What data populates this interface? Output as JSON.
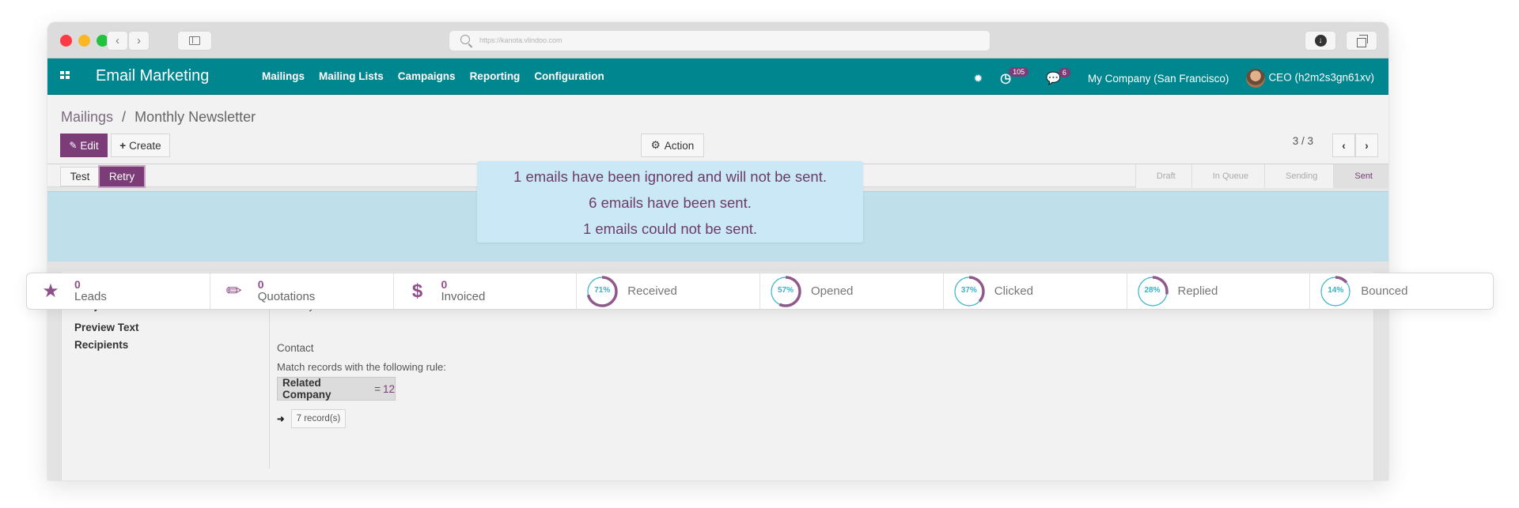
{
  "browser": {
    "url": "https://kanota.vlindoo.com",
    "back_icon": "chevron-left-icon",
    "forward_icon": "chevron-right-icon",
    "sidebar_icon": "sidebar-icon",
    "download_icon": "download-icon",
    "tabs_icon": "tabs-icon"
  },
  "navbar": {
    "app_title": "Email Marketing",
    "menu": [
      "Mailings",
      "Mailing Lists",
      "Campaigns",
      "Reporting",
      "Configuration"
    ],
    "activity_count": "105",
    "messages_count": "6",
    "company": "My Company (San Francisco)",
    "user": "CEO (h2m2s3gn61xv)"
  },
  "breadcrumb": {
    "parent": "Mailings",
    "separator": "/",
    "current": "Monthly Newsletter"
  },
  "toolbar": {
    "edit_label": "Edit",
    "create_label": "Create",
    "action_label": "Action",
    "pager": "3 / 3"
  },
  "header_buttons": {
    "test_label": "Test",
    "retry_label": "Retry"
  },
  "stages": [
    {
      "label": "Draft",
      "active": false
    },
    {
      "label": "In Queue",
      "active": false
    },
    {
      "label": "Sending",
      "active": false
    },
    {
      "label": "Sent",
      "active": true
    }
  ],
  "alert": {
    "lines": [
      "1  emails have been ignored and will not be sent.",
      "6  emails have been sent.",
      "1  emails could not be sent."
    ]
  },
  "stats": {
    "counters": [
      {
        "value": "0",
        "label": "Leads",
        "icon": "star-icon"
      },
      {
        "value": "0",
        "label": "Quotations",
        "icon": "pencil-icon"
      },
      {
        "value": "0",
        "label": "Invoiced",
        "icon": "dollar-icon"
      }
    ],
    "rates": [
      {
        "percent": 71,
        "text": "71%",
        "label": "Received"
      },
      {
        "percent": 57,
        "text": "57%",
        "label": "Opened"
      },
      {
        "percent": 37,
        "text": "37%",
        "label": "Clicked"
      },
      {
        "percent": 28,
        "text": "28%",
        "label": "Replied"
      },
      {
        "percent": 14,
        "text": "14%",
        "label": "Bounced"
      }
    ]
  },
  "form": {
    "subject_label": "Subject",
    "subject_value": "Monthly Newsletter",
    "preview_label": "Preview Text",
    "preview_value": "",
    "recipients_label": "Recipients",
    "recipients_value": "Contact",
    "rule_text": "Match records with the following rule:",
    "rule_field": "Related Company",
    "rule_operator": "=",
    "rule_value": "12",
    "records_label": "7 record(s)"
  },
  "colors": {
    "navbar": "#00868f",
    "primary": "#7c3c78",
    "ring_track": "#36b3c7",
    "ring_fill": "#8f5a8b",
    "alert_bg": "#cbe8f6"
  }
}
